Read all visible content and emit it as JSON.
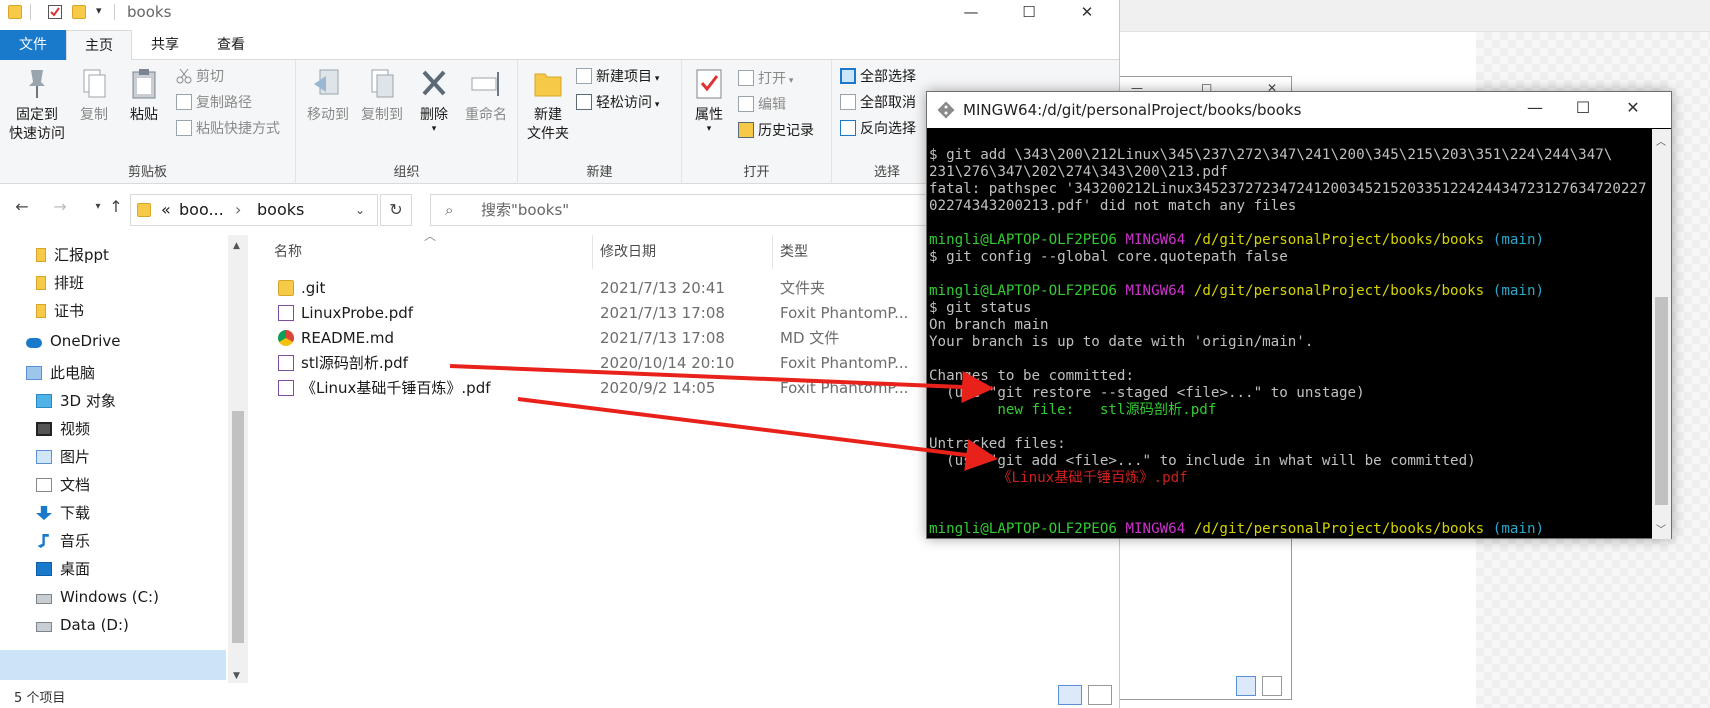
{
  "explorer": {
    "title": "books",
    "tabs": [
      "文件",
      "主页",
      "共享",
      "查看"
    ],
    "help": "?",
    "ribbon": {
      "clipboard": {
        "label": "剪贴板",
        "pin": "固定到\n快速访问",
        "pin_l1": "固定到",
        "pin_l2": "快速访问",
        "copy": "复制",
        "paste": "粘贴",
        "cut": "剪切",
        "copy_path": "复制路径",
        "paste_shortcut": "粘贴快捷方式"
      },
      "organize": {
        "label": "组织",
        "move_to": "移动到",
        "copy_to": "复制到",
        "delete": "删除",
        "rename": "重命名"
      },
      "new": {
        "label": "新建",
        "new_folder_l1": "新建",
        "new_folder_l2": "文件夹",
        "new_item": "新建项目",
        "easy_access": "轻松访问"
      },
      "open": {
        "label": "打开",
        "properties": "属性",
        "open": "打开",
        "edit": "编辑",
        "history": "历史记录"
      },
      "select": {
        "label": "选择",
        "select_all": "全部选择",
        "select_none": "全部取消",
        "invert": "反向选择"
      }
    },
    "address": {
      "chevrons": "«",
      "parent": "boo...",
      "separator": "›",
      "current": "books"
    },
    "search_placeholder": "搜索\"books\"",
    "sidebar": [
      {
        "label": "汇报ppt",
        "icon": "folder-icon"
      },
      {
        "label": "排班",
        "icon": "folder-icon"
      },
      {
        "label": "证书",
        "icon": "folder-icon"
      },
      {
        "label": "OneDrive",
        "icon": "cloud-icon"
      },
      {
        "label": "此电脑",
        "icon": "computer-icon"
      },
      {
        "label": "3D 对象",
        "icon": "cube-icon"
      },
      {
        "label": "视频",
        "icon": "video-icon"
      },
      {
        "label": "图片",
        "icon": "picture-icon"
      },
      {
        "label": "文档",
        "icon": "document-icon"
      },
      {
        "label": "下载",
        "icon": "download-icon"
      },
      {
        "label": "音乐",
        "icon": "music-icon"
      },
      {
        "label": "桌面",
        "icon": "desktop-icon"
      },
      {
        "label": "Windows (C:)",
        "icon": "drive-icon"
      },
      {
        "label": "Data (D:)",
        "icon": "drive-icon"
      }
    ],
    "columns": [
      "名称",
      "修改日期",
      "类型"
    ],
    "files": [
      {
        "name": ".git",
        "date": "2021/7/13 20:41",
        "type": "文件夹",
        "icon": "folder-icon"
      },
      {
        "name": "LinuxProbe.pdf",
        "date": "2021/7/13 17:08",
        "type": "Foxit PhantomP...",
        "icon": "pdf-icon"
      },
      {
        "name": "README.md",
        "date": "2021/7/13 17:08",
        "type": "MD 文件",
        "icon": "chrome-icon"
      },
      {
        "name": "stl源码剖析.pdf",
        "date": "2020/10/14 20:10",
        "type": "Foxit PhantomP...",
        "icon": "pdf-icon"
      },
      {
        "name": "《Linux基础千锤百炼》.pdf",
        "date": "2020/9/2 14:05",
        "type": "Foxit PhantomP...",
        "icon": "pdf-icon"
      }
    ],
    "status": "5 个项目"
  },
  "terminal": {
    "title": "MINGW64:/d/git/personalProject/books/books",
    "lines": {
      "l1": "$ git add \\343\\200\\212Linux\\345\\237\\272\\347\\241\\200\\345\\215\\203\\351\\224\\244\\347\\",
      "l2": "231\\276\\347\\202\\274\\343\\200\\213.pdf",
      "l3": "fatal: pathspec '343200212Linux34523727234724120034521520335122424434723127634720227",
      "l3b": "02274343200213.pdf' did not match any files",
      "prompt_user": "mingli@LAPTOP-OLF2PEO6",
      "prompt_env": "MINGW64",
      "prompt_path": "/d/git/personalProject/books/books",
      "prompt_branch": "(main)",
      "cmd_config": "$ git config --global core.quotepath false",
      "cmd_status": "$ git status",
      "on_branch": "On branch main",
      "up_to_date": "Your branch is up to date with 'origin/main'.",
      "changes_header": "Changes to be committed:",
      "changes_hint": "  (use \"git restore --staged <file>...\" to unstage)",
      "new_file": "        new file:   stl源码剖析.pdf",
      "untracked_header": "Untracked files:",
      "untracked_hint": "  (use \"git add <file>...\" to include in what will be committed)",
      "untracked_file": "        《Linux基础千锤百炼》.pdf",
      "final_prompt": "$ "
    }
  },
  "colors": {
    "accent": "#1979ca",
    "arrow": "#e8221b",
    "term_green": "#33cc33",
    "term_magenta": "#cc33cc",
    "term_yellow": "#d4d400",
    "term_cyan": "#2aa7c9",
    "term_red": "#cc2020"
  }
}
